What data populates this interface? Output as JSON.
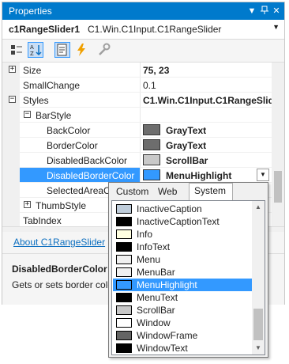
{
  "window": {
    "title": "Properties"
  },
  "object_selector": {
    "name": "c1RangeSlider1",
    "type": "C1.Win.C1Input.C1RangeSlider"
  },
  "toolbar": {
    "icons": [
      "categorized-icon",
      "alphabetical-icon",
      "properties-icon",
      "events-icon",
      "property-pages-icon"
    ]
  },
  "grid": {
    "rows": [
      {
        "label": "Size",
        "value": "75, 23",
        "expander": "+",
        "bold": true
      },
      {
        "label": "SmallChange",
        "value": "0.1"
      },
      {
        "label": "Styles",
        "value": "C1.Win.C1Input.C1RangeSlid",
        "expander": "−",
        "bold": true
      },
      {
        "label": "BarStyle",
        "value": "",
        "expander": "−"
      },
      {
        "label": "BackColor",
        "value": "GrayText",
        "swatch": "#6d6d6d",
        "bold": true
      },
      {
        "label": "BorderColor",
        "value": "GrayText",
        "swatch": "#6d6d6d",
        "bold": true
      },
      {
        "label": "DisabledBackColor",
        "value": "ScrollBar",
        "swatch": "#c8c8c8",
        "bold": true
      },
      {
        "label": "DisabledBorderColor",
        "value": "MenuHighlight",
        "swatch": "#3399ff",
        "bold": true
      },
      {
        "label": "SelectedAreaCo",
        "value": ""
      },
      {
        "label": "ThumbStyle",
        "value": "",
        "expander": "+"
      },
      {
        "label": "TabIndex",
        "value": ""
      }
    ]
  },
  "commands": {
    "link": "About C1RangeSlider"
  },
  "description": {
    "name": "DisabledBorderColor",
    "text": "Gets or sets border colo"
  },
  "color_popup": {
    "tabs": [
      "Custom",
      "Web",
      "System"
    ],
    "active_tab": "System",
    "items": [
      {
        "name": "InactiveCaption",
        "color": "#bfcddb"
      },
      {
        "name": "InactiveCaptionText",
        "color": "#000000"
      },
      {
        "name": "Info",
        "color": "#ffffe1"
      },
      {
        "name": "InfoText",
        "color": "#000000"
      },
      {
        "name": "Menu",
        "color": "#f0f0f0"
      },
      {
        "name": "MenuBar",
        "color": "#f0f0f0"
      },
      {
        "name": "MenuHighlight",
        "color": "#3399ff"
      },
      {
        "name": "MenuText",
        "color": "#000000"
      },
      {
        "name": "ScrollBar",
        "color": "#c8c8c8"
      },
      {
        "name": "Window",
        "color": "#ffffff"
      },
      {
        "name": "WindowFrame",
        "color": "#646464"
      },
      {
        "name": "WindowText",
        "color": "#000000"
      }
    ],
    "selected": "MenuHighlight"
  }
}
